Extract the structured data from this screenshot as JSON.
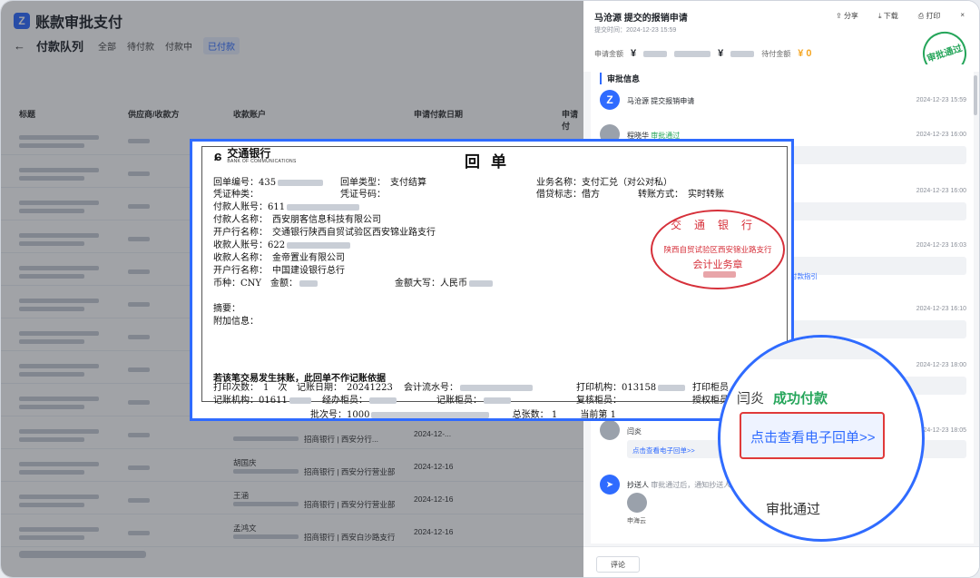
{
  "app": {
    "title": "账款审批支付",
    "logo_letter": "Z",
    "page_title": "付款队列",
    "tabs": [
      "全部",
      "待付款",
      "付款中",
      "已付款"
    ],
    "columns": [
      "标题",
      "供应商/收款方",
      "收款账户",
      "申请付款日期",
      "申请付"
    ],
    "rows": [
      {
        "payee": "",
        "bank": "",
        "date": ""
      },
      {
        "payee": "",
        "bank": "",
        "date": ""
      },
      {
        "payee": "",
        "bank": "",
        "date": ""
      },
      {
        "payee": "",
        "bank": "",
        "date": ""
      },
      {
        "payee": "",
        "bank": "",
        "date": ""
      },
      {
        "payee": "",
        "bank": "",
        "date": ""
      },
      {
        "payee": "",
        "bank": "",
        "date": ""
      },
      {
        "payee": "",
        "bank": "",
        "date": ""
      },
      {
        "payee": "",
        "bank": "",
        "date": ""
      },
      {
        "payee": "",
        "bank": "招商银行 | 西安分行...",
        "date": "2024-12-..."
      },
      {
        "payee": "胡国庆",
        "bank": "招商银行 | 西安分行营业部",
        "date": "2024-12-16"
      },
      {
        "payee": "王涵",
        "bank": "招商银行 | 西安分行营业部",
        "date": "2024-12-16"
      },
      {
        "payee": "孟鸿文",
        "bank": "招商银行 | 西安白沙路支行",
        "date": "2024-12-16"
      }
    ]
  },
  "panel": {
    "title": "马沧源 提交的报销申请",
    "submit_time": "提交时间：2024-12-23 15:59",
    "actions": {
      "share": "分享",
      "download": "下载",
      "print": "打印",
      "close": "×"
    },
    "amount_label": "申请金额",
    "amount_prefix": "¥",
    "pending_label": "待付金额",
    "pending_value": "¥ 0",
    "stamp_text": "审批通过",
    "section_title": "审批信息",
    "timeline": [
      {
        "name": "马沧源",
        "action": "提交报销申请",
        "date": "2024-12-23 15:59"
      },
      {
        "name": "程晓华",
        "action": "审批通过",
        "date": "2024-12-23 16:00"
      },
      {
        "name": "",
        "action": "",
        "date": "2024-12-23 16:00"
      },
      {
        "name": "",
        "action": "",
        "date": "2024-12-23 16:03"
      },
      {
        "name": "",
        "action": "",
        "date": "2024-12-23 16:10"
      },
      {
        "name": "",
        "action": "",
        "date": "2024-12-23 18:00"
      },
      {
        "name": "闫炎",
        "action": "成功付款",
        "date": "2024-12-23 18:05"
      }
    ],
    "guide_link": "付款指引",
    "receipt_link": "点击查看电子回单>>",
    "cc_name": "抄送人",
    "cc_desc": "审批通过后，通知抄送人",
    "cc_person": "申海云",
    "comment_button": "评论"
  },
  "receipt": {
    "bank_name": "交通银行",
    "bank_en": "BANK OF COMMUNICATIONS",
    "title": "回单",
    "receipt_no_label": "回单编号：",
    "receipt_no_prefix": "435",
    "receipt_type": "回单类型：　支付结算",
    "business_name": "业务名称：支付汇兑（对公对私）",
    "voucher_type": "凭证种类：",
    "voucher_no": "凭证号码：",
    "debit_credit": "借贷标志：借方",
    "transfer_method": "转账方式：　实时转账",
    "payer_account_label": "付款人账号：",
    "payer_account_prefix": "611",
    "payer_name": "付款人名称：　西安朋客信息科技有限公司",
    "payer_bank": "开户行名称：　交通银行陕西自贸试验区西安锦业路支行",
    "payee_account_label": "收款人账号：",
    "payee_account_prefix": "622",
    "payee_name": "收款人名称：　金帝置业有限公司",
    "payee_bank": "开户行名称：　中国建设银行总行",
    "currency": "币种：CNY　金额：",
    "amount_cn": "金额大写：人民币",
    "summary": "摘要：",
    "extra_info": "附加信息：",
    "warning": "若该笔交易发生抹账，此回单不作记账依据",
    "print_count": "打印次数：　1　次",
    "posting_date": "记账日期：　20241223",
    "serial_no": "会计流水号：",
    "print_org": "打印机构：013158",
    "print_teller": "打印柜员",
    "posting_org": "记账机构：01611",
    "handler": "经办柜员：",
    "posting_teller": "记账柜员：",
    "review_teller": "复核柜员：",
    "auth_teller": "授权柜员",
    "batch_no": "批次号：1000",
    "total_count": "总张数：",
    "total_count_value": "1",
    "current_no": "当前第",
    "current_no_value": "1",
    "seal_top": "交通银行",
    "seal_mid": "陕西自贸试验区西安锦业路支行",
    "seal_bottom": "会计业务章"
  },
  "magnifier": {
    "name": "闫炎",
    "status": "成功付款",
    "link": "点击查看电子回单>>",
    "bottom_text": "审批通过"
  }
}
